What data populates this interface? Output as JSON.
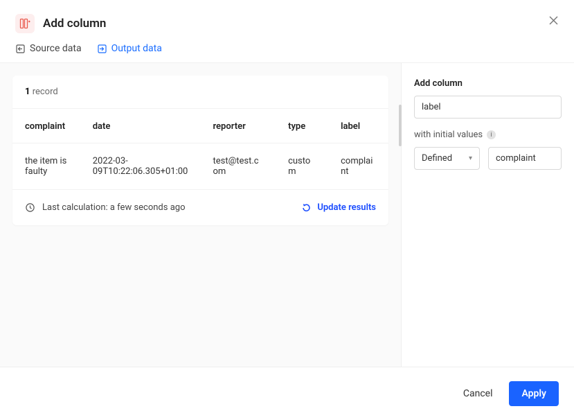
{
  "header": {
    "title": "Add column"
  },
  "tabs": {
    "source": "Source data",
    "output": "Output data"
  },
  "records": {
    "count": "1",
    "label": "record"
  },
  "table": {
    "headers": {
      "complaint": "complaint",
      "date": "date",
      "reporter": "reporter",
      "type": "type",
      "label": "label"
    },
    "row": {
      "complaint": "the item is faulty",
      "date": "2022-03-09T10:22:06.305+01:00",
      "reporter": "test@test.com",
      "type": "custom",
      "label": "complaint"
    }
  },
  "footer_card": {
    "last_calc": "Last calculation: a few seconds ago",
    "update": "Update results"
  },
  "sidebar": {
    "title": "Add column",
    "name_value": "label",
    "initial_label": "with initial values",
    "mode": "Defined",
    "value": "complaint"
  },
  "actions": {
    "cancel": "Cancel",
    "apply": "Apply"
  }
}
